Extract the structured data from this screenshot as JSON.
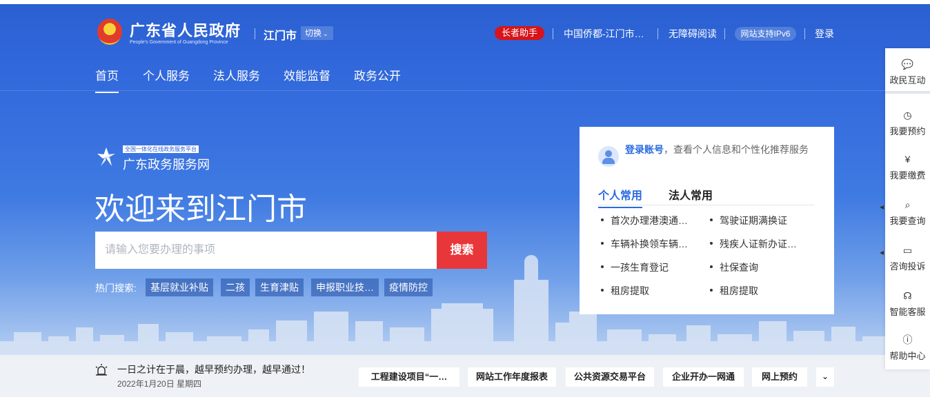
{
  "header": {
    "site_name": "广东省人民政府",
    "site_name_en": "People's Government of Guangdong Province",
    "city": "江门市",
    "switch_label": "切换",
    "elder_assist": "长者助手",
    "links": [
      "中国侨都-江门市…",
      "无障碍阅读",
      "网站支持IPv6",
      "登录"
    ]
  },
  "nav": {
    "items": [
      "首页",
      "个人服务",
      "法人服务",
      "效能监督",
      "政务公开"
    ],
    "active_index": 0
  },
  "portal": {
    "subtitle": "全国一体化在线政务服务平台",
    "name": "广东政务服务网"
  },
  "welcome_title": "欢迎来到江门市",
  "search": {
    "placeholder": "请输入您要办理的事项",
    "button_label": "搜索",
    "hot_label": "热门搜索:",
    "hot_keywords": [
      "基层就业补贴",
      "二孩",
      "生育津贴",
      "申报职业技…",
      "疫情防控"
    ]
  },
  "login_card": {
    "login_link": "登录账号",
    "login_text": "，查看个人信息和个性化推荐服务",
    "tabs": [
      "个人常用",
      "法人常用"
    ],
    "active_tab": 0,
    "services": [
      "首次办理港澳通…",
      "驾驶证期满换证",
      "车辆补换领车辆…",
      "残疾人证新办证…",
      "一孩生育登记",
      "社保查询",
      "租房提取",
      "租房提取"
    ]
  },
  "notice": {
    "text": "一日之计在于晨，越早预约办理，越早通过！",
    "date": "2022年1月20日 星期四"
  },
  "quick_links": [
    "工程建设项目“一…",
    "网站工作年度报表",
    "公共资源交易平台",
    "企业开办一网通",
    "网上预约"
  ],
  "sidebar": {
    "items": [
      "政民互动",
      "我要预约",
      "我要缴费",
      "我要查询",
      "咨询投诉",
      "智能客服",
      "帮助中心"
    ]
  },
  "colors": {
    "primary_blue": "#2a5fd1",
    "search_red": "#e8373a",
    "elder_red": "#d7141a",
    "link_blue": "#2a6ae0"
  }
}
